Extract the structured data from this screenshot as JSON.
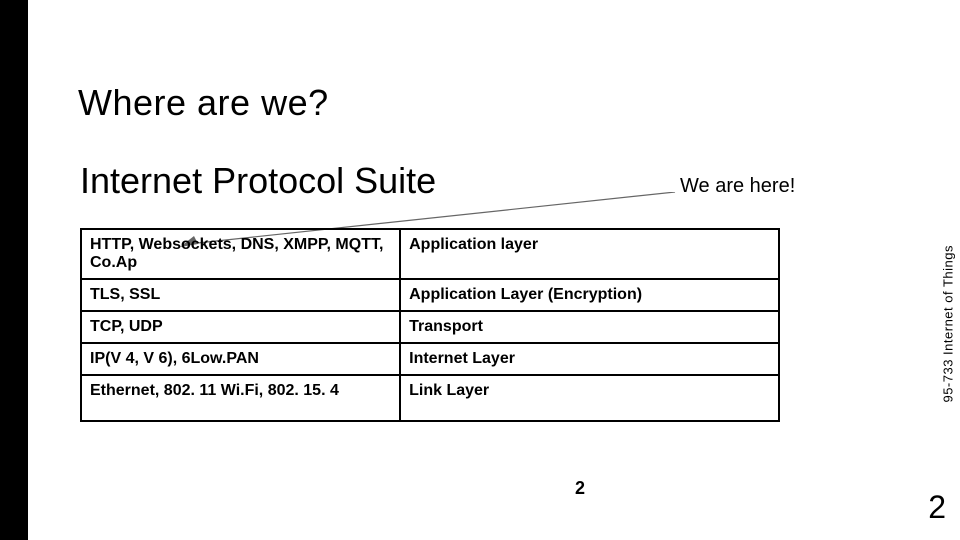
{
  "title": "Where are we?",
  "subtitle": "Internet Protocol Suite",
  "annotation": "We are here!",
  "side_label": "95-733 Internet of Things",
  "page_center": "2",
  "page_right": "2",
  "rows": [
    {
      "c1": "HTTP, Websockets, DNS, XMPP, MQTT, Co.Ap",
      "c2": "Application layer"
    },
    {
      "c1": "TLS, SSL",
      "c2": "Application Layer (Encryption)"
    },
    {
      "c1": "TCP, UDP",
      "c2": "Transport"
    },
    {
      "c1": "IP(V 4, V 6), 6Low.PAN",
      "c2": "Internet Layer"
    },
    {
      "c1": "Ethernet, 802. 11 Wi.Fi, 802. 15. 4",
      "c2": "Link Layer"
    }
  ]
}
